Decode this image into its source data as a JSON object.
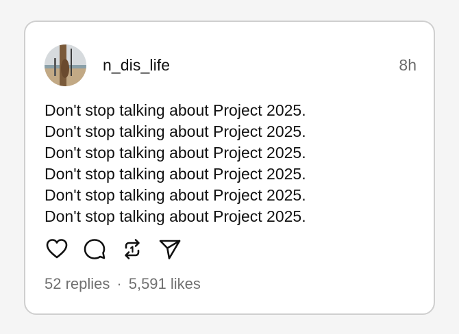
{
  "post": {
    "username": "n_dis_life",
    "timestamp": "8h",
    "lines": [
      "Don't stop talking about Project 2025.",
      "Don't stop talking about Project 2025.",
      "Don't stop talking about Project 2025.",
      "Don't stop talking about Project 2025.",
      "Don't stop talking about Project 2025.",
      "Don't stop talking about Project 2025."
    ],
    "replies": "52 replies",
    "separator": "·",
    "likes": "5,591 likes"
  },
  "icons": {
    "like": "heart-icon",
    "reply": "comment-icon",
    "repost": "repost-icon",
    "share": "send-icon"
  },
  "colors": {
    "text": "#111111",
    "muted": "#707070",
    "border": "#cfcfcf",
    "background": "#f5f5f5",
    "card": "#ffffff"
  }
}
